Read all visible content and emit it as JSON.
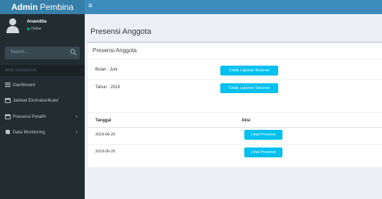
{
  "header": {
    "logo_bold": "Admin",
    "logo_rest": " Pembina"
  },
  "user": {
    "name": "Anandita",
    "status": "Online"
  },
  "sidebar": {
    "search_placeholder": "Search...",
    "nav_header": "MAIN NAVIGATION",
    "items": [
      {
        "label": "Dashboard",
        "icon": "list-icon",
        "has_chevron": false
      },
      {
        "label": "Jadwal Ekstrakurikuler",
        "icon": "calendar-icon",
        "has_chevron": false
      },
      {
        "label": "Presensi Pelatih",
        "icon": "calendar-icon",
        "has_chevron": true
      },
      {
        "label": "Data Monitoring",
        "icon": "book-icon",
        "has_chevron": true
      }
    ]
  },
  "main": {
    "page_title": "Presensi Anggota",
    "box_title": "Presensi Anggota",
    "bulan_label": "Bulan : Juni",
    "tahun_label": "Tahun : 2019",
    "btn_bulanan": "Cetak Laporan Bulanan",
    "btn_tahunan": "Cetak Laporan Tahunan",
    "table": {
      "columns": [
        "Tanggal",
        "Aksi"
      ],
      "rows": [
        {
          "tanggal": "2019-06-20",
          "action": "Lihat Presensi"
        },
        {
          "tanggal": "2019-06-20",
          "action": "Lihat Presensi"
        }
      ]
    }
  },
  "colors": {
    "accent": "#3c8dbc",
    "button": "#00c0ef",
    "sidebar": "#222d32"
  }
}
